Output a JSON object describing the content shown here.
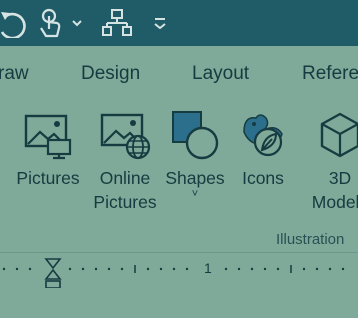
{
  "quick_access": {
    "items": [
      {
        "icon": "redo-icon"
      },
      {
        "icon": "touch-mode-icon"
      },
      {
        "icon": "dropdown-arrow-icon"
      },
      {
        "icon": "org-chart-icon"
      },
      {
        "icon": "customize-toolbar-icon"
      }
    ]
  },
  "tabs": [
    "raw",
    "Design",
    "Layout",
    "Refere"
  ],
  "ribbon": {
    "buttons": [
      {
        "label": "Pictures",
        "icon": "pictures-icon"
      },
      {
        "label_line1": "Online",
        "label_line2": "Pictures",
        "icon": "online-pictures-icon"
      },
      {
        "label": "Shapes",
        "icon": "shapes-icon",
        "dropdown": "˅"
      },
      {
        "label": "Icons",
        "icon": "icons-icon"
      },
      {
        "label_line1": "3D",
        "label_line2": "Models",
        "icon": "3d-models-icon"
      }
    ],
    "group_label": "Illustration"
  },
  "ruler": {
    "number": "1"
  },
  "colors": {
    "titlebar": "#1f5c68",
    "ribbon_bg": "#7fa998",
    "text": "#163b40",
    "icon_fill_blue": "#2b6f8c"
  }
}
